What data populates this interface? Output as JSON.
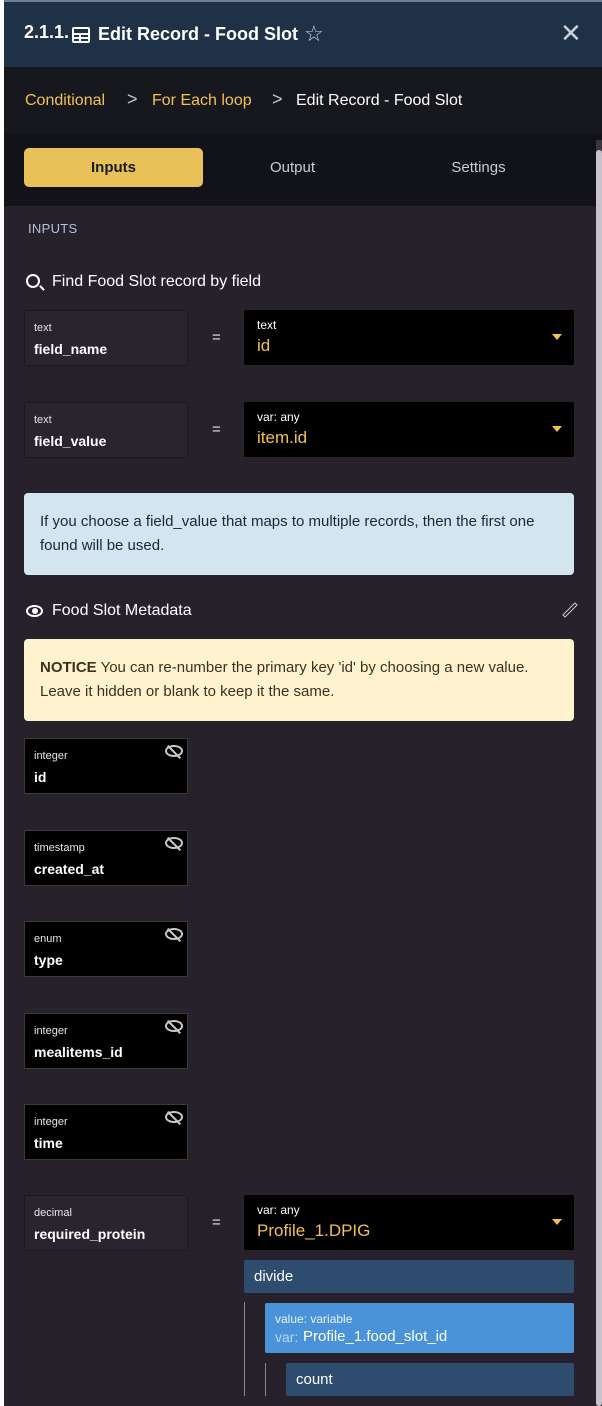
{
  "header": {
    "step": "2.1.1.",
    "title": "Edit Record - Food Slot",
    "icon": "table-icon"
  },
  "breadcrumb": {
    "items": [
      "Conditional",
      "For Each loop",
      "Edit Record - Food Slot"
    ],
    "separator": ">"
  },
  "tabs": [
    {
      "label": "Inputs",
      "active": true
    },
    {
      "label": "Output",
      "active": false
    },
    {
      "label": "Settings",
      "active": false
    }
  ],
  "inputs": {
    "section_label": "INPUTS",
    "find_label": "Find Food Slot record by field",
    "rows": [
      {
        "type": "text",
        "name": "field_name",
        "op": "=",
        "value_type": "text",
        "value": "id"
      },
      {
        "type": "text",
        "name": "field_value",
        "op": "=",
        "value_type": "var: any",
        "value": "item.id"
      }
    ],
    "info": "If you choose a field_value that maps to multiple records, then the first one found will be used."
  },
  "metadata": {
    "title": "Food Slot Metadata",
    "notice_strong": "NOTICE",
    "notice_text": " You can re-number the primary key 'id' by choosing a new value. Leave it hidden or blank to keep it the same.",
    "hidden_fields": [
      {
        "type": "integer",
        "name": "id"
      },
      {
        "type": "timestamp",
        "name": "created_at"
      },
      {
        "type": "enum",
        "name": "type"
      },
      {
        "type": "integer",
        "name": "mealitems_id"
      },
      {
        "type": "integer",
        "name": "time"
      }
    ],
    "protein": {
      "type": "decimal",
      "name": "required_protein",
      "op": "=",
      "value_type": "var: any",
      "value": "Profile_1.DPIG",
      "filter": "divide",
      "arg_type": "value: variable",
      "arg_prefix": "var:",
      "arg_value": "Profile_1.food_slot_id",
      "sub_filter": "count"
    }
  },
  "colors": {
    "accent": "#f2c150",
    "header_bg": "#1e3146",
    "panel_bg": "#27212b",
    "info_bg": "#d3e6ef",
    "notice_bg": "#fff3cf",
    "filter_bg": "#2e4c6e",
    "variable_bg": "#4a93d8"
  }
}
